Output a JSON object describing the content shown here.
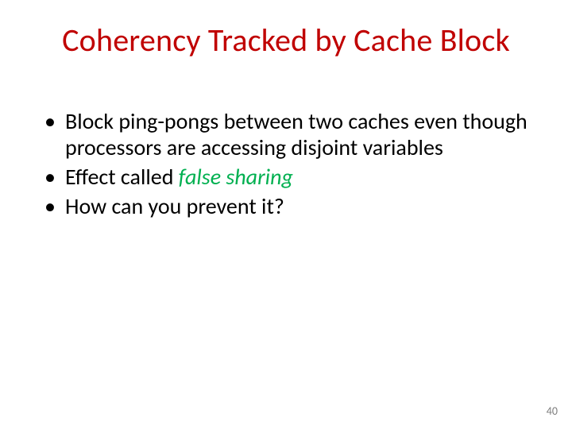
{
  "slide": {
    "title": "Coherency Tracked by Cache Block",
    "bullets": [
      {
        "pre": "Block ping-pongs between two caches even though processors are accessing disjoint variables",
        "em": "",
        "post": ""
      },
      {
        "pre": "Effect called ",
        "em": "false sharing",
        "post": ""
      },
      {
        "pre": "How can you prevent it?",
        "em": "",
        "post": ""
      }
    ],
    "page_number": "40"
  }
}
